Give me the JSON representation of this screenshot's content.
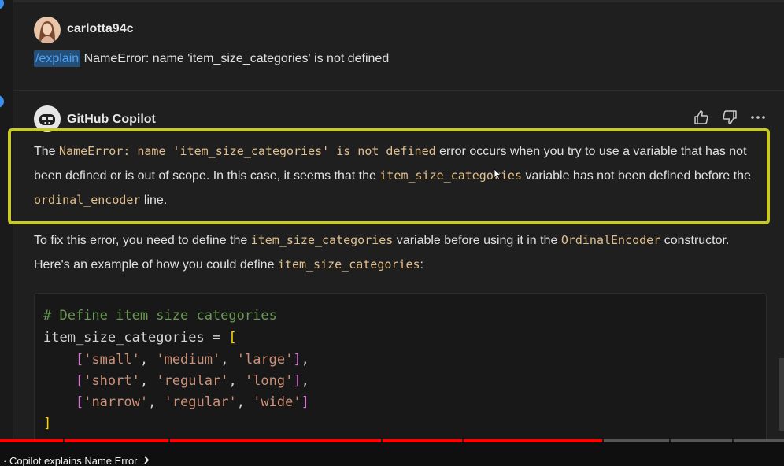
{
  "user": {
    "name": "carlotta94c",
    "command": "/explain",
    "message": " NameError: name 'item_size_categories' is not defined"
  },
  "assistant": {
    "name": "GitHub Copilot",
    "actions": [
      "thumbs-up-icon",
      "thumbs-down-icon",
      "more-icon"
    ],
    "para1": {
      "t1": "The ",
      "c1": "NameError: name 'item_size_categories' is not defined",
      "t2": " error occurs when you try to use a variable that has not been defined or is out of scope. In this case, it seems that the ",
      "c2": "item_size_categories",
      "t3": " variable has not been defined before the ",
      "c3": "ordinal_encoder",
      "t4": " line."
    },
    "para2": {
      "t1": "To fix this error, you need to define the ",
      "c1": "item_size_categories",
      "t2": " variable before using it in the ",
      "c2": "OrdinalEncoder",
      "t3": " constructor. Here's an example of how you could define ",
      "c3": "item_size_categories",
      "t4": ":"
    },
    "code": {
      "comment": "# Define item size categories",
      "line2_name": "item_size_categories = ",
      "row1": [
        "'small'",
        "'medium'",
        "'large'"
      ],
      "row2": [
        "'short'",
        "'regular'",
        "'long'"
      ],
      "row3": [
        "'narrow'",
        "'regular'",
        "'wide'"
      ]
    }
  },
  "video": {
    "chapter": "· Copilot explains Name Error",
    "progress": 0.77
  },
  "colors": {
    "highlight": "#c9c928",
    "code_text": "#e2c08d",
    "progress": "#ff0000"
  }
}
